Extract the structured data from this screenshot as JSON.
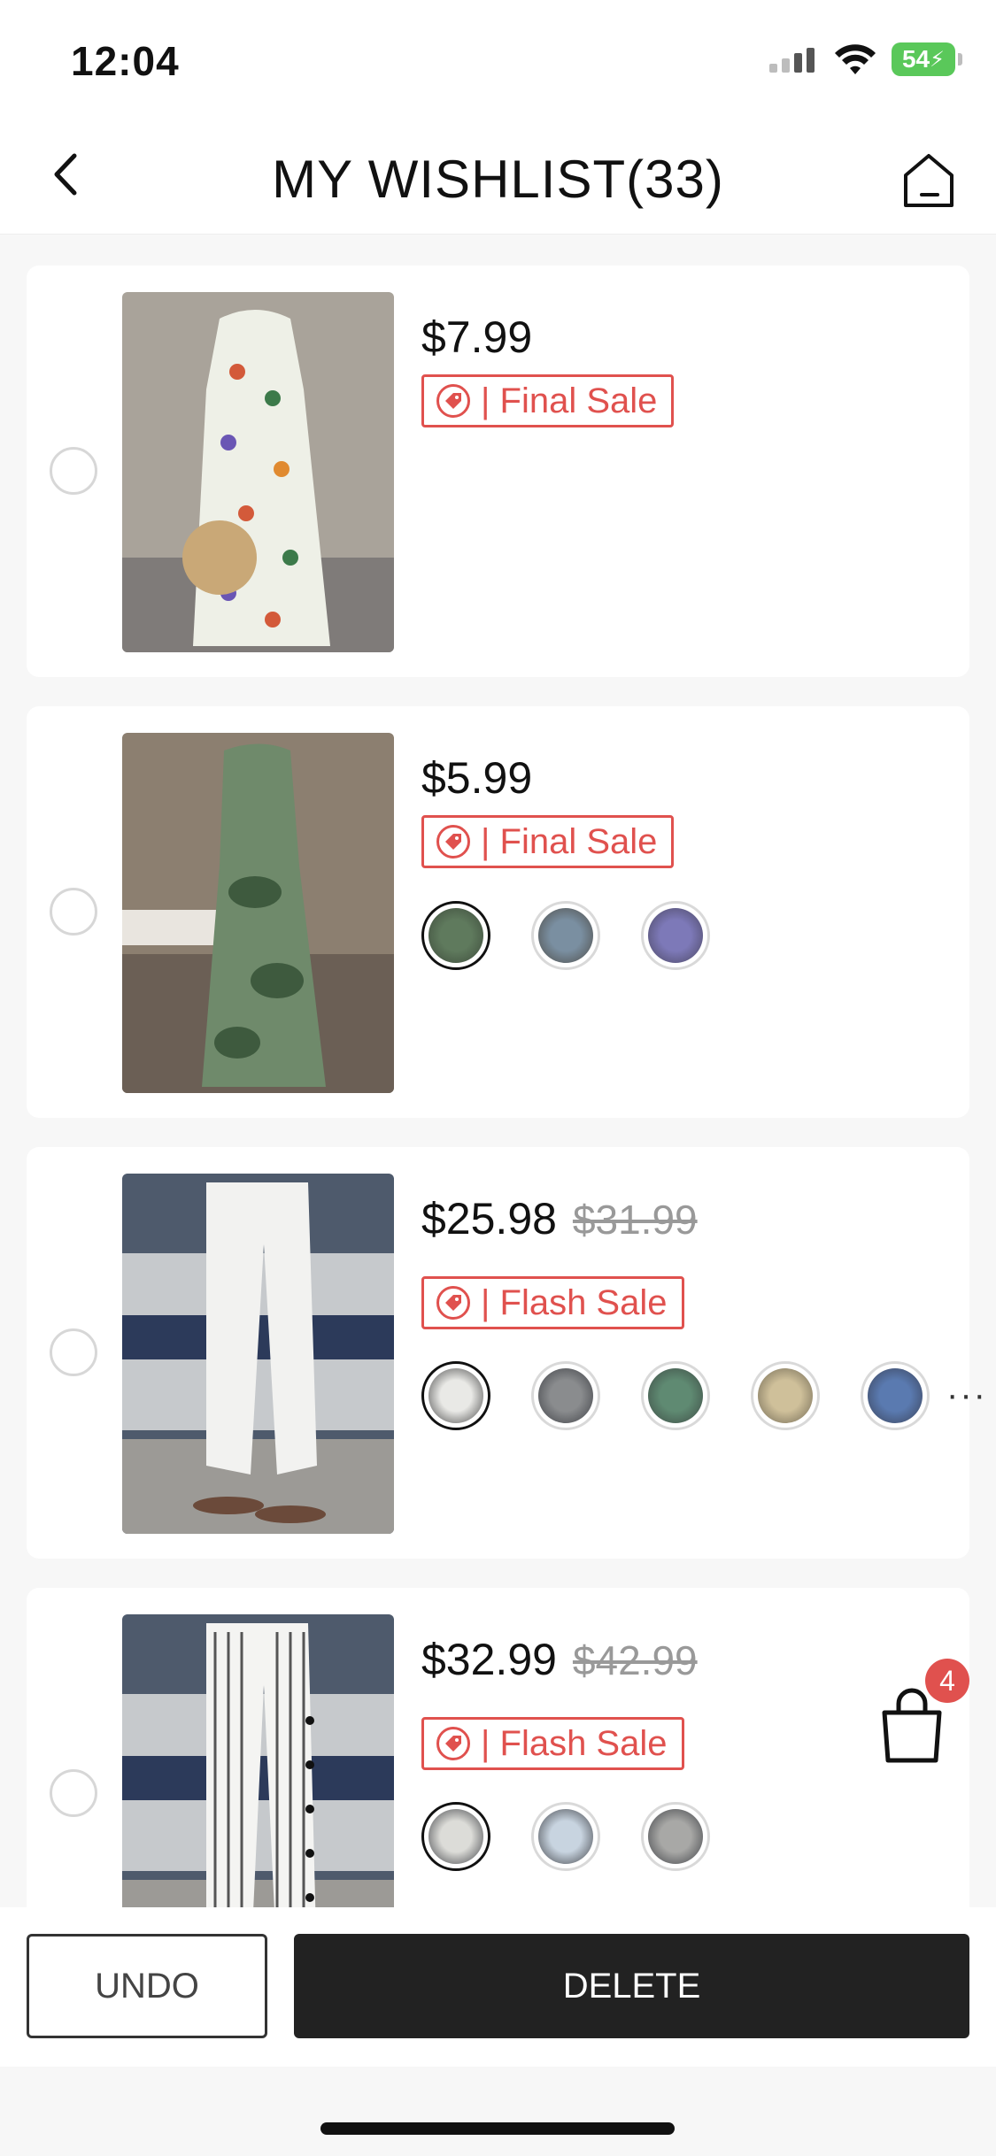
{
  "status_bar": {
    "time": "12:04",
    "battery": "54"
  },
  "header": {
    "title": "MY WISHLIST(33)"
  },
  "items": [
    {
      "price": "$7.99",
      "original_price": "",
      "tag_label": "| Final Sale",
      "swatches": []
    },
    {
      "price": "$5.99",
      "original_price": "",
      "tag_label": "| Final Sale",
      "swatches": [
        "green-tie-dye",
        "blue-grey",
        "purple"
      ]
    },
    {
      "price": "$25.98",
      "original_price": "$31.99",
      "tag_label": "| Flash Sale",
      "swatches": [
        "white",
        "grey",
        "green",
        "khaki",
        "blue"
      ],
      "more": "···"
    },
    {
      "price": "$32.99",
      "original_price": "$42.99",
      "tag_label": "| Flash Sale",
      "swatches": [
        "black-stripe",
        "light-blue",
        "grey"
      ]
    }
  ],
  "cart": {
    "badge_count": "4"
  },
  "actions": {
    "undo_label": "UNDO",
    "delete_label": "DELETE"
  },
  "colors": {
    "accent": "#e0514e",
    "delete_bg": "#222222",
    "battery": "#5ac85a"
  }
}
